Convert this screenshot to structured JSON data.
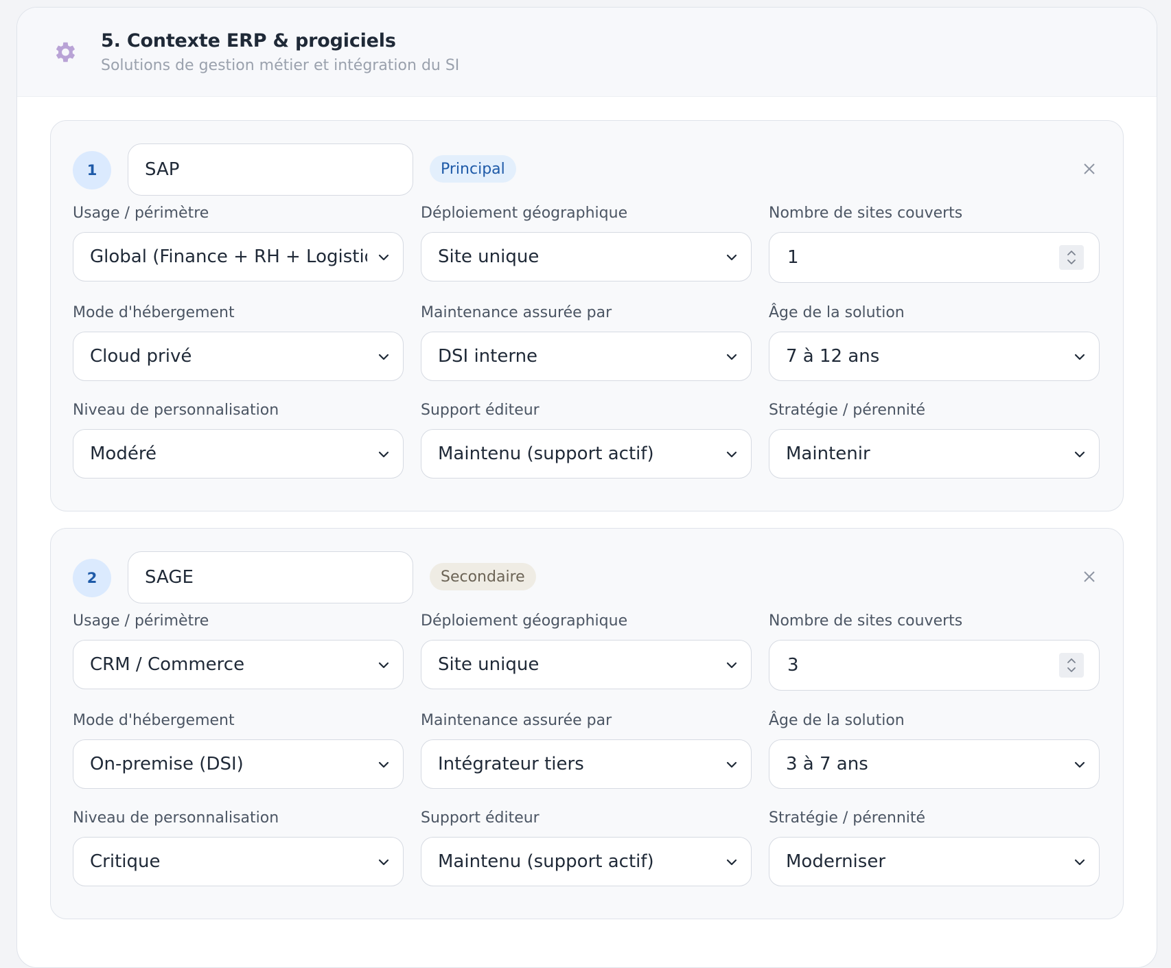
{
  "section": {
    "title": "5. Contexte ERP & progiciels",
    "subtitle": "Solutions de gestion métier et intégration du SI",
    "icon": "gear-icon"
  },
  "labels": {
    "usage": "Usage / périmètre",
    "deploiement": "Déploiement géographique",
    "sites": "Nombre de sites couverts",
    "hebergement": "Mode d'hébergement",
    "maintenance": "Maintenance assurée par",
    "age": "Âge de la solution",
    "personnalisation": "Niveau de personnalisation",
    "support": "Support éditeur",
    "strategie": "Stratégie / pérennité"
  },
  "erps": [
    {
      "index": "1",
      "name": "SAP",
      "tag": "Principal",
      "usage": "Global (Finance + RH + Logistique)",
      "deploiement": "Site unique",
      "sites": "1",
      "hebergement": "Cloud privé",
      "maintenance": "DSI interne",
      "age": "7 à 12 ans",
      "personnalisation": "Modéré",
      "support": "Maintenu (support actif)",
      "strategie": "Maintenir"
    },
    {
      "index": "2",
      "name": "SAGE",
      "tag": "Secondaire",
      "usage": "CRM / Commerce",
      "deploiement": "Site unique",
      "sites": "3",
      "hebergement": "On-premise (DSI)",
      "maintenance": "Intégrateur tiers",
      "age": "3 à 7 ans",
      "personnalisation": "Critique",
      "support": "Maintenu (support actif)",
      "strategie": "Moderniser"
    }
  ],
  "colors": {
    "accent": "#1e5aa8",
    "badge_bg": "#dbeafe",
    "secondary_tag_bg": "#efece4",
    "gear": "#a78bc9"
  }
}
